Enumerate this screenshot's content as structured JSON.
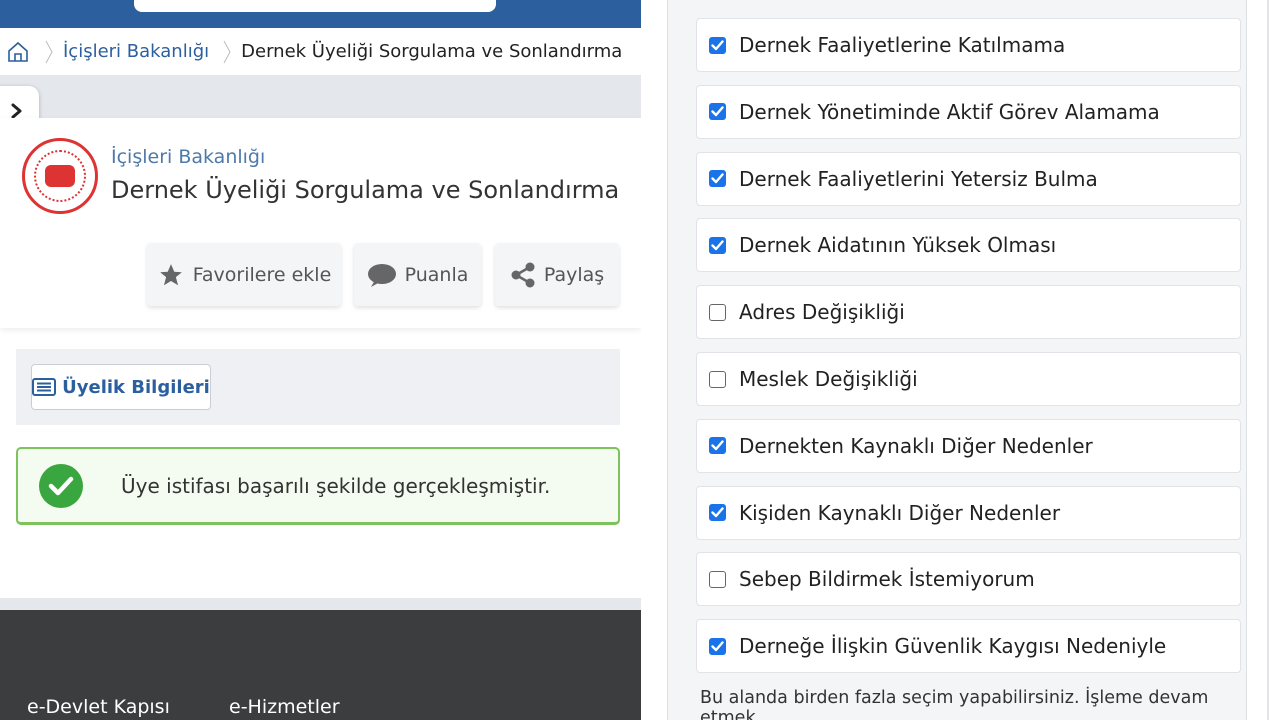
{
  "breadcrumb": {
    "link": "İçişleri Bakanlığı",
    "current": "Dernek Üyeliği Sorgulama ve Sonlandırma"
  },
  "service": {
    "ministry": "İçişleri Bakanlığı",
    "title": "Dernek Üyeliği Sorgulama ve Sonlandırma"
  },
  "actions": {
    "favorite": "Favorilere ekle",
    "rate": "Puanla",
    "share": "Paylaş"
  },
  "tabs": {
    "membership_info": "Üyelik Bilgileri"
  },
  "alert": {
    "message": "Üye istifası başarılı şekilde gerçekleşmiştir."
  },
  "footer": {
    "col1": "e-Devlet Kapısı",
    "col2": "e-Hizmetler"
  },
  "reasons": [
    {
      "label": "Dernek Faaliyetlerine Katılmama",
      "checked": true
    },
    {
      "label": "Dernek Yönetiminde Aktif Görev Alamama",
      "checked": true
    },
    {
      "label": "Dernek Faaliyetlerini Yetersiz Bulma",
      "checked": true
    },
    {
      "label": "Dernek Aidatının Yüksek Olması",
      "checked": true
    },
    {
      "label": "Adres Değişikliği",
      "checked": false
    },
    {
      "label": "Meslek Değişikliği",
      "checked": false
    },
    {
      "label": "Dernekten Kaynaklı Diğer Nedenler",
      "checked": true
    },
    {
      "label": "Kişiden Kaynaklı Diğer Nedenler",
      "checked": true
    },
    {
      "label": "Sebep Bildirmek İstemiyorum",
      "checked": false
    },
    {
      "label": "Derneğe İlişkin Güvenlik Kaygısı Nedeniyle",
      "checked": true
    }
  ],
  "note": "Bu alanda birden fazla seçim yapabilirsiniz. İşleme devam etmek",
  "colors": {
    "brand_blue": "#2b5f9e",
    "success_green": "#3aa63f",
    "checkbox_blue": "#1a73e8",
    "seal_red": "#d33"
  }
}
